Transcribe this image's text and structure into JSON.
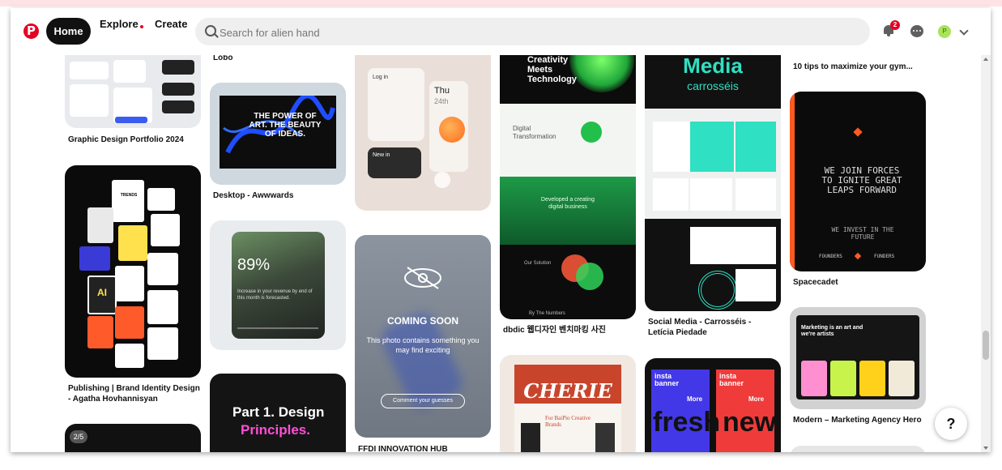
{
  "header": {
    "logo_glyph": "P",
    "home": "Home",
    "explore": "Explore",
    "create": "Create",
    "search_placeholder": "Search for alien hand",
    "notification_count": "2",
    "avatar_initial": "P"
  },
  "pins": {
    "c1": {
      "p1_caption": "Graphic Design Portfolio 2024",
      "p2_caption": "Publishing | Brand Identity Design - Agatha Hovhannisyan",
      "p2_tag": "TRENDS",
      "p2_word": "AI",
      "p3_badge": "2/5"
    },
    "c2": {
      "p1_caption": "Lobo",
      "p2_caption": "Desktop - Awwwards",
      "p2_art": "THE POWER OF ART. THE BEAUTY OF IDEAS.",
      "p3_percent": "89%",
      "p3_text": "Increase in your revenue by end of this month is forecasted.",
      "p4_line1": "Part 1. Design",
      "p4_line2": "Principles."
    },
    "c3": {
      "p1_thu": "Thu",
      "p1_date": "24th",
      "p1_login": "Log in",
      "p1_newin": "New in",
      "p2_title": "COMING SOON",
      "p2_text": "This photo contains something you may find exciting",
      "p2_button": "Comment your guesses",
      "p2_caption": "FFDI INNOVATION HUB"
    },
    "c4": {
      "p1_line1": "Creativity",
      "p1_line2": "Meets",
      "p1_line3": "Technology",
      "p1_sub1": "Digital",
      "p1_sub2": "Transformation",
      "p1_mid": "Developed a creating digital business",
      "p1_sol": "Our Solution",
      "p1_by": "By The Numbers",
      "p1_caption": "dbdic 웹디자인 벤치마킹 사진",
      "p2_title": "CHERIE",
      "p2_sub": "For BaiPio Creative Brands"
    },
    "c5": {
      "p1_title": "Media",
      "p1_sub": "carrosséis",
      "p1_caption": "Social Media - Carrosséis - Letícia Piedade",
      "p2_brand": "insta banner",
      "p2_more": "More",
      "p2_big": "fresh",
      "p2_new": "new"
    },
    "c6": {
      "p1_caption": "10 tips to maximize your gym...",
      "p2_text1": "WE JOIN FORCES TO IGNITE GREAT LEAPS FORWARD",
      "p2_text2": "WE INVEST IN THE FUTURE",
      "p2_founders": "FOUNDERS",
      "p2_funders": "FUNDERS",
      "p2_caption": "Spacecadet",
      "p3_head": "Marketing is an art and we're artists",
      "p3_caption": "Modern – Marketing Agency Hero"
    }
  },
  "help": "?"
}
